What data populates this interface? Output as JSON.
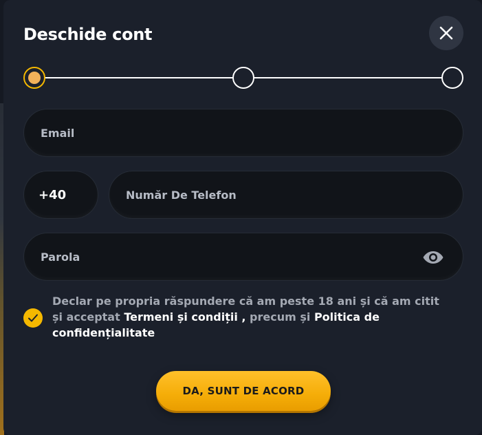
{
  "modal": {
    "title": "Deschide cont"
  },
  "stepper": {
    "steps": [
      {
        "state": "active"
      },
      {
        "state": "inactive"
      },
      {
        "state": "inactive"
      }
    ]
  },
  "form": {
    "email": {
      "placeholder": "Email",
      "value": ""
    },
    "phone_prefix": {
      "value": "+40"
    },
    "phone": {
      "placeholder": "Număr De Telefon",
      "value": ""
    },
    "password": {
      "placeholder": "Parola",
      "value": ""
    }
  },
  "consent": {
    "checked": true,
    "text_part1": "Declar pe propria răspundere că am peste 18 ani și că am citit și acceptat ",
    "terms_link": "Termeni și condiții ,",
    "text_part2": " precum și ",
    "privacy_link": "Politica de confidențialitate"
  },
  "submit": {
    "label": "DA, SUNT DE ACORD"
  },
  "icons": {
    "close": "close-icon",
    "show_password": "eye-icon",
    "checkbox": "checkmark-icon"
  },
  "colors": {
    "accent": "#f5b800",
    "modal_bg": "#1b202b",
    "field_bg": "#111419",
    "text_muted": "#a4a9b3"
  }
}
